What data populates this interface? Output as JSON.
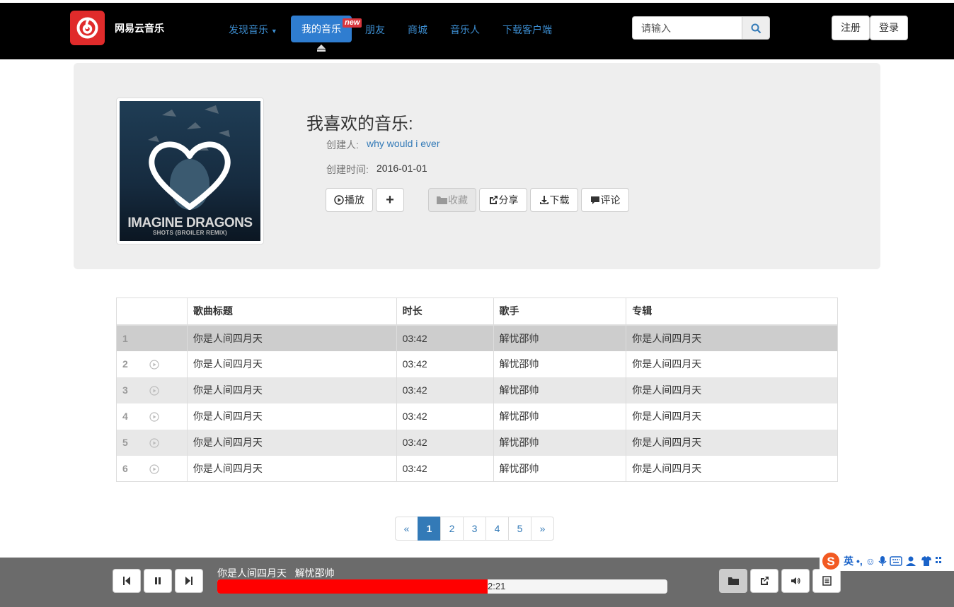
{
  "navbar": {
    "brand_name": "网易云音乐",
    "items": [
      {
        "label": "发现音乐"
      },
      {
        "label": "我的音乐"
      },
      {
        "label": "朋友"
      },
      {
        "label": "商城"
      },
      {
        "label": "音乐人"
      },
      {
        "label": "下载客户端"
      }
    ],
    "new_badge": "new",
    "search_placeholder": "请输入",
    "register_label": "注册",
    "login_label": "登录"
  },
  "playlist": {
    "title": "我喜欢的音乐:",
    "creator_label": "创建人:",
    "creator": "why would i ever",
    "created_label": "创建时间:",
    "created": "2016-01-01",
    "cover_text_main": "IMAGINE DRAGONS",
    "cover_text_sub": "SHOTS (BROILER REMIX)",
    "actions": {
      "play": "播放",
      "collect": "收藏",
      "share": "分享",
      "download": "下载",
      "comment": "评论"
    }
  },
  "table": {
    "headers": [
      "歌曲标题",
      "时长",
      "歌手",
      "专辑"
    ],
    "rows": [
      {
        "index": "1",
        "title": "你是人间四月天",
        "duration": "03:42",
        "artist": "解忧邵帅",
        "album": "你是人间四月天"
      },
      {
        "index": "2",
        "title": "你是人间四月天",
        "duration": "03:42",
        "artist": "解忧邵帅",
        "album": "你是人间四月天"
      },
      {
        "index": "3",
        "title": "你是人间四月天",
        "duration": "03:42",
        "artist": "解忧邵帅",
        "album": "你是人间四月天"
      },
      {
        "index": "4",
        "title": "你是人间四月天",
        "duration": "03:42",
        "artist": "解忧邵帅",
        "album": "你是人间四月天"
      },
      {
        "index": "5",
        "title": "你是人间四月天",
        "duration": "03:42",
        "artist": "解忧邵帅",
        "album": "你是人间四月天"
      },
      {
        "index": "6",
        "title": "你是人间四月天",
        "duration": "03:42",
        "artist": "解忧邵帅",
        "album": "你是人间四月天"
      }
    ]
  },
  "pagination": {
    "prev": "«",
    "pages": [
      "1",
      "2",
      "3",
      "4",
      "5"
    ],
    "next": "»",
    "current": "1"
  },
  "player": {
    "song": "你是人间四月天",
    "artist": "解忧邵帅",
    "time": "2:21",
    "progress": 0.6
  },
  "ime": {
    "mode": "英"
  },
  "colors": {
    "accent": "#337ab7",
    "brand": "#e02b2b",
    "progress": "#ff0000"
  }
}
